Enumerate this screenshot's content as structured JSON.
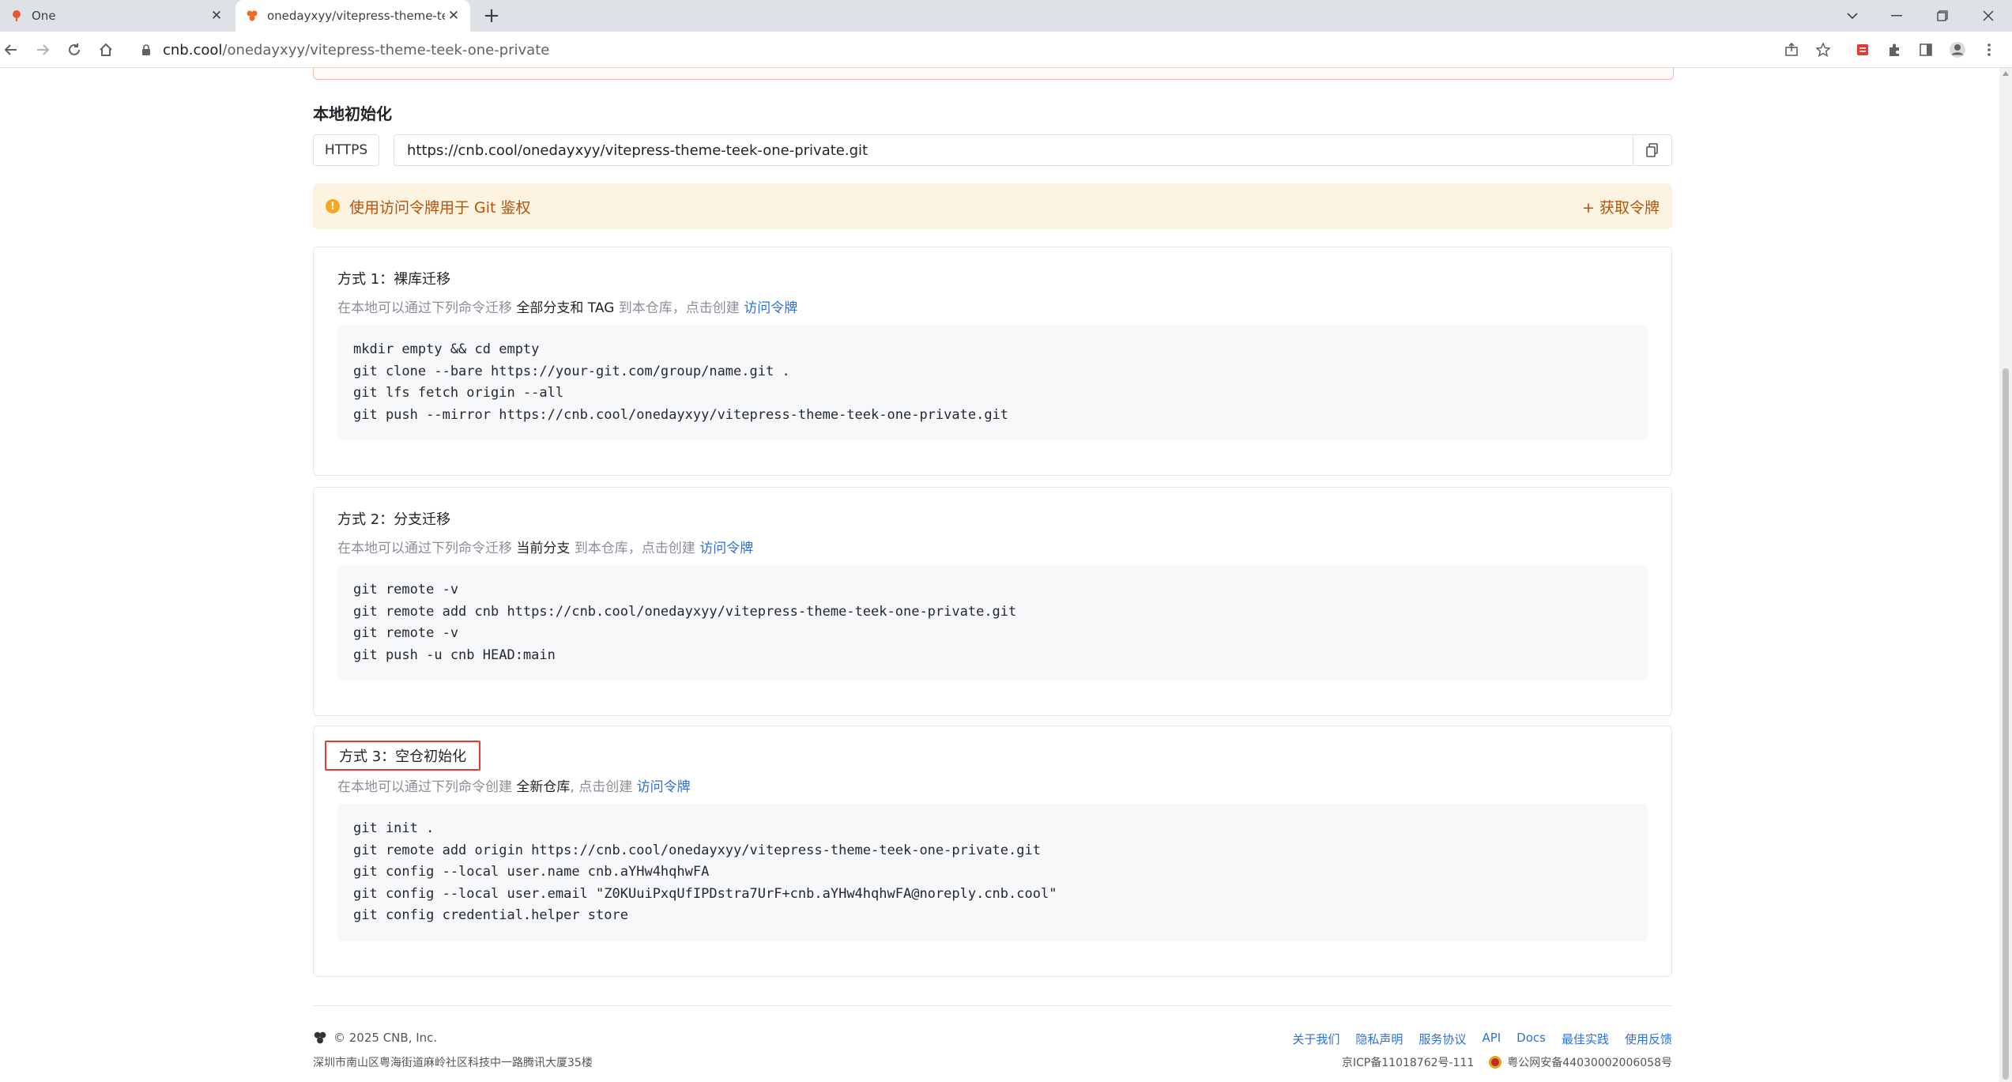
{
  "browser": {
    "tabs": [
      {
        "title": "One",
        "active": false
      },
      {
        "title": "onedayxyy/vitepress-theme-te",
        "active": true
      }
    ],
    "url_host": "cnb.cool",
    "url_path": "/onedayxyy/vitepress-theme-teek-one-private"
  },
  "page": {
    "section_title": "本地初始化",
    "protocol": "HTTPS",
    "clone_url": "https://cnb.cool/onedayxyy/vitepress-theme-teek-one-private.git",
    "notice": {
      "message": "使用访问令牌用于 Git 鉴权",
      "action": "+ 获取令牌"
    },
    "methods": [
      {
        "title": "方式 1：裸库迁移",
        "desc_prefix": "在本地可以通过下列命令迁移",
        "desc_emphasis": "全部分支和 TAG",
        "desc_suffix": "到本仓库，点击创建",
        "link": "访问令牌",
        "code": [
          "mkdir empty && cd empty",
          "git clone --bare https://your-git.com/group/name.git .",
          "git lfs fetch origin --all",
          "git push --mirror https://cnb.cool/onedayxyy/vitepress-theme-teek-one-private.git"
        ]
      },
      {
        "title": "方式 2：分支迁移",
        "desc_prefix": "在本地可以通过下列命令迁移",
        "desc_emphasis": "当前分支",
        "desc_suffix": "到本仓库，点击创建",
        "link": "访问令牌",
        "code": [
          "git remote -v",
          "git remote add cnb https://cnb.cool/onedayxyy/vitepress-theme-teek-one-private.git",
          "git remote -v",
          "git push -u cnb HEAD:main"
        ]
      },
      {
        "title": "方式 3：空仓初始化",
        "desc_prefix": "在本地可以通过下列命令创建",
        "desc_emphasis": "全新仓库",
        "desc_suffix": ", 点击创建",
        "link": "访问令牌",
        "code": [
          "git init .",
          "git remote add origin https://cnb.cool/onedayxyy/vitepress-theme-teek-one-private.git",
          "git config --local user.name cnb.aYHw4hqhwFA",
          "git config --local user.email \"Z0KUuiPxqUfIPDstra7UrF+cnb.aYHw4hqhwFA@noreply.cnb.cool\"",
          "git config credential.helper store"
        ]
      }
    ]
  },
  "footer": {
    "copyright": "© 2025 CNB, Inc.",
    "address": "深圳市南山区粤海街道麻岭社区科技中一路腾讯大厦35楼",
    "links": [
      "关于我们",
      "隐私声明",
      "服务协议",
      "API",
      "Docs",
      "最佳实践",
      "使用反馈"
    ],
    "icp": "京ICP备11018762号-111",
    "police": "粤公网安备44030002006058号"
  },
  "colors": {
    "accent": "#2f6fd6",
    "notice_bg": "#fdf3e1",
    "notice_text": "#b4540a",
    "highlight_border": "#e53935"
  }
}
